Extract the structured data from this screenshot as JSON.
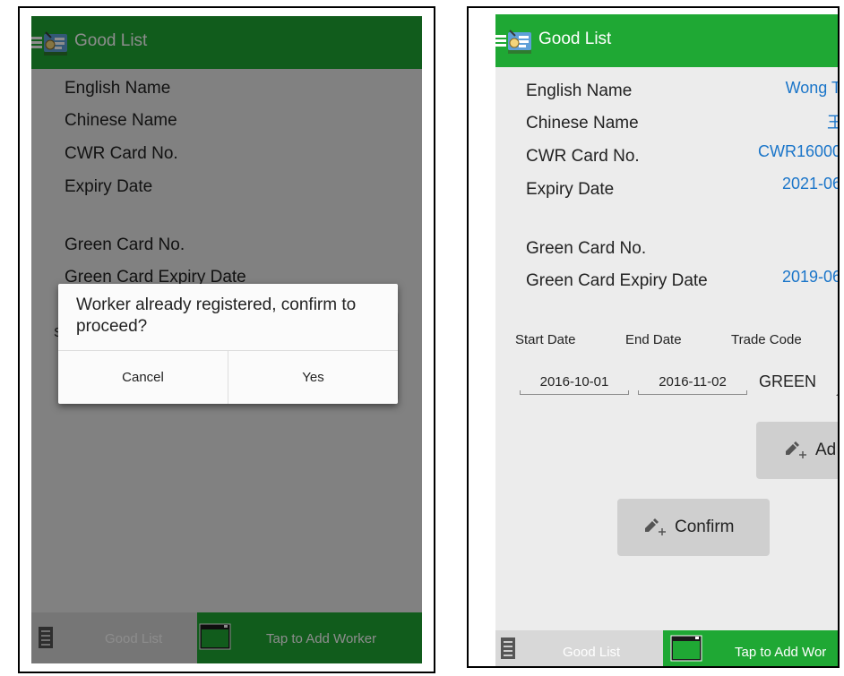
{
  "left_screen": {
    "app_title": "Good List",
    "fields": [
      {
        "label": "English Name"
      },
      {
        "label": "Chinese Name"
      },
      {
        "label": "CWR Card No."
      },
      {
        "label": "Expiry Date"
      },
      {
        "label": "Green Card No."
      },
      {
        "label": "Green Card Expiry Date"
      }
    ],
    "partial_label": "S",
    "dialog": {
      "message": "Worker already registered, confirm to proceed?",
      "cancel_label": "Cancel",
      "yes_label": "Yes"
    },
    "bottom_bar": {
      "left_label": "Good List",
      "right_label": "Tap to Add Worker"
    }
  },
  "right_screen": {
    "app_title": "Good List",
    "fields": [
      {
        "label": "English Name",
        "value": "Wong T"
      },
      {
        "label": "Chinese Name",
        "value": "王"
      },
      {
        "label": "CWR Card No.",
        "value": "CWR16000"
      },
      {
        "label": "Expiry Date",
        "value": "2021-06"
      },
      {
        "label": "Green Card No.",
        "value": ""
      },
      {
        "label": "Green Card Expiry Date",
        "value": "2019-06"
      }
    ],
    "table_headers": {
      "start": "Start Date",
      "end": "End Date",
      "trade": "Trade Code"
    },
    "start_date": "2016-10-01",
    "end_date": "2016-11-02",
    "trade_code": "GREEN",
    "add_button_label": "Ad",
    "confirm_button_label": "Confirm",
    "bottom_bar": {
      "left_label": "Good List",
      "right_label": "Tap to Add Wor"
    }
  },
  "colors": {
    "app_bar_green": "#1fa834",
    "value_blue": "#1a75c9",
    "button_grey": "#cfcfcf"
  }
}
